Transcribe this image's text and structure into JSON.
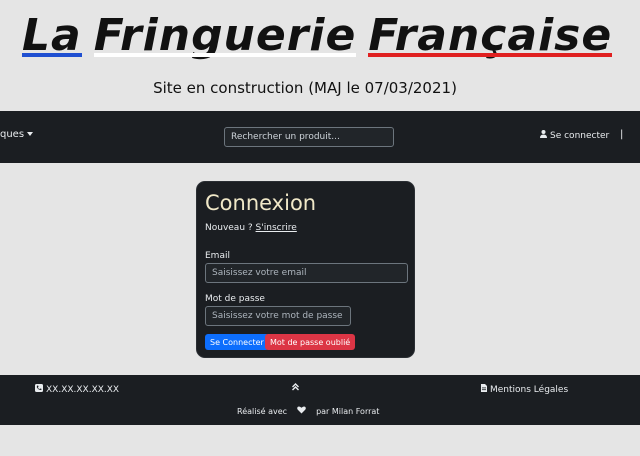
{
  "header": {
    "brand_words": [
      "La",
      "Fringuerie",
      "Française"
    ],
    "subtitle": "Site en construction (MAJ le 07/03/2021)"
  },
  "navbar": {
    "left_menu_label": "ques",
    "search_placeholder": "Rechercher un produit...",
    "login_label": "Se connecter",
    "separator": "|"
  },
  "login_card": {
    "title": "Connexion",
    "new_prefix": "Nouveau ?",
    "signup_link": "S'inscrire",
    "email_label": "Email",
    "email_placeholder": "Saisissez votre email",
    "password_label": "Mot de passe",
    "password_placeholder": "Saisissez votre mot de passe",
    "submit_label": "Se Connecter",
    "forgot_label": "Mot de passe oublié"
  },
  "footer": {
    "phone": "XX.XX.XX.XX.XX",
    "legal_label": "Mentions Légales",
    "made_prefix": "Réalisé avec",
    "made_suffix": "par Milan Forrat"
  },
  "colors": {
    "dark": "#1b1e22",
    "primary": "#0d6efd",
    "danger": "#dc3545",
    "flag_blue": "#1f4fd1",
    "flag_red": "#e02020"
  },
  "icons": {
    "login": "user-icon",
    "phone": "phone-icon",
    "up": "chevron-double-up-icon",
    "legal": "document-icon",
    "heart": "heart-icon"
  }
}
